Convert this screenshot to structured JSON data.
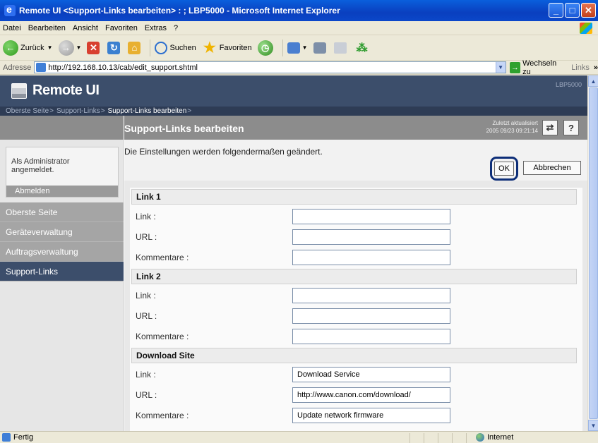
{
  "window": {
    "title": "Remote UI <Support-Links bearbeiten> : ; LBP5000 - Microsoft Internet Explorer"
  },
  "menu": [
    "Datei",
    "Bearbeiten",
    "Ansicht",
    "Favoriten",
    "Extras",
    "?"
  ],
  "toolbar": {
    "back": "Zurück",
    "search": "Suchen",
    "favorites": "Favoriten"
  },
  "address": {
    "label": "Adresse",
    "url": "http://192.168.10.13/cab/edit_support.shtml",
    "go": "Wechseln zu",
    "links": "Links"
  },
  "status": {
    "text": "Fertig",
    "zone": "Internet"
  },
  "rui": {
    "logo": "Remote UI",
    "model": "LBP5000",
    "breadcrumb": [
      "Oberste Seite",
      "Support-Links",
      "Support-Links bearbeiten"
    ],
    "admin_text": "Als Administrator angemeldet.",
    "logout": "Abmelden",
    "nav": [
      "Oberste Seite",
      "Geräteverwaltung",
      "Auftragsverwaltung",
      "Support-Links"
    ],
    "page_title": "Support-Links bearbeiten",
    "last_updated_label": "Zuletzt aktualisiert",
    "last_updated_value": "2005 09/23 09:21:14",
    "refresh_icon": "refresh-icon",
    "help": "?",
    "message": "Die Einstellungen werden folgendermaßen geändert.",
    "ok": "OK",
    "cancel": "Abbrechen"
  },
  "form": {
    "sections": [
      {
        "title": "Link 1",
        "fields": [
          {
            "label": "Link :",
            "value": ""
          },
          {
            "label": "URL :",
            "value": ""
          },
          {
            "label": "Kommentare :",
            "value": ""
          }
        ]
      },
      {
        "title": "Link 2",
        "fields": [
          {
            "label": "Link :",
            "value": ""
          },
          {
            "label": "URL :",
            "value": ""
          },
          {
            "label": "Kommentare :",
            "value": ""
          }
        ]
      },
      {
        "title": "Download Site",
        "fields": [
          {
            "label": "Link :",
            "value": "Download Service"
          },
          {
            "label": "URL :",
            "value": "http://www.canon.com/download/"
          },
          {
            "label": "Kommentare :",
            "value": "Update network firmware"
          }
        ]
      }
    ]
  },
  "colors": {
    "header": "#3c4e6b",
    "highlight_ring": "#0d2e78",
    "sidebar_active": "#3c4e6b"
  }
}
